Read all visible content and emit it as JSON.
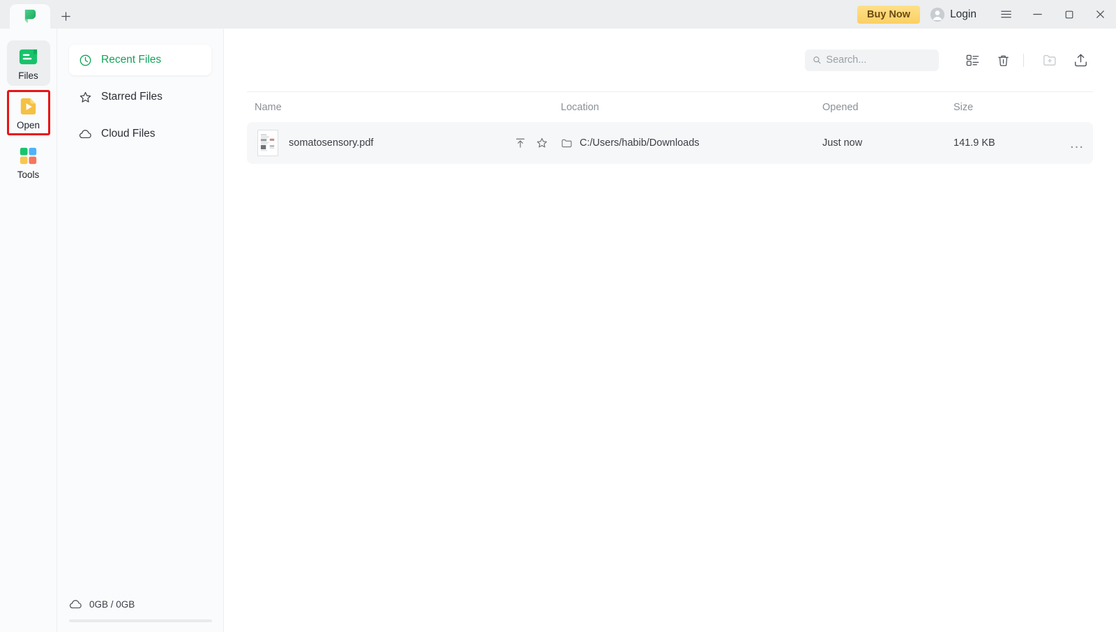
{
  "titlebar": {
    "logo_icon": "app-logo-green-p",
    "new_tab_icon": "plus-icon",
    "buy_now_label": "Buy Now",
    "login_label": "Login",
    "avatar_icon": "user-avatar-icon",
    "menu_icon": "hamburger-menu-icon",
    "minimize_icon": "minimize-icon",
    "maximize_icon": "maximize-icon",
    "close_icon": "close-icon"
  },
  "rail": {
    "items": [
      {
        "label": "Files",
        "icon": "files-icon",
        "active": true
      },
      {
        "label": "Open",
        "icon": "open-play-icon",
        "active": false
      },
      {
        "label": "Tools",
        "icon": "tools-grid-icon",
        "active": false
      }
    ]
  },
  "nav": {
    "items": [
      {
        "label": "Recent Files",
        "icon": "clock-icon",
        "active": true
      },
      {
        "label": "Starred Files",
        "icon": "star-icon",
        "active": false
      },
      {
        "label": "Cloud Files",
        "icon": "cloud-icon",
        "active": false
      }
    ],
    "storage": {
      "icon": "cloud-icon",
      "text": "0GB / 0GB",
      "used_percent": 0
    }
  },
  "toolbar": {
    "search": {
      "placeholder": "Search...",
      "value": "",
      "icon": "search-icon"
    },
    "buttons": [
      {
        "name": "list-view-icon"
      },
      {
        "name": "trash-icon"
      },
      {
        "name": "new-folder-icon"
      },
      {
        "name": "upload-icon"
      }
    ]
  },
  "table": {
    "columns": [
      "Name",
      "Location",
      "Opened",
      "Size"
    ],
    "rows": [
      {
        "name": "somatosensory.pdf",
        "thumbnail_icon": "pdf-page-thumbnail",
        "pin_icon": "pin-to-top-icon",
        "star_icon": "star-icon",
        "folder_icon": "folder-icon",
        "location": "C:/Users/habib/Downloads",
        "opened": "Just now",
        "size": "141.9 KB",
        "more_label": "…"
      }
    ]
  },
  "colors": {
    "brand_green": "#12a35a",
    "buy_now_bg": "#fbcf63",
    "buy_now_text": "#6b4a12",
    "annotation_red": "#e81414",
    "row_bg": "#f6f7f8"
  }
}
